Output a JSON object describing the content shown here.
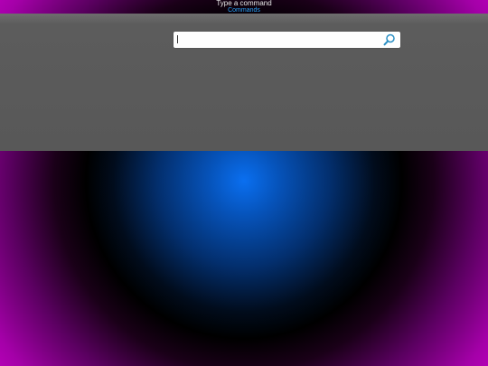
{
  "hint": {
    "title": "Type a command",
    "link": "Commands"
  },
  "search": {
    "value": "",
    "placeholder": ""
  },
  "icons": {
    "search": "search-icon"
  },
  "colors": {
    "panel": "#585858",
    "link": "#2aa7ff",
    "sphere": "#0a6ff0",
    "corner": "#c300c3"
  }
}
